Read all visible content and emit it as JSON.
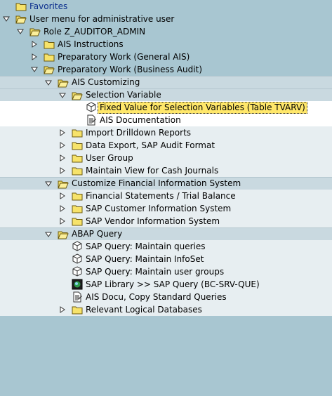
{
  "favorites": "Favorites",
  "user_menu": "User menu for administrative user",
  "role": "Role Z_AUDITOR_ADMIN",
  "ais_instructions": "AIS Instructions",
  "prep_general": "Preparatory Work (General AIS)",
  "prep_business": "Preparatory Work (Business Audit)",
  "ais_customizing": "AIS Customizing",
  "selection_variable": "Selection Variable",
  "fixed_value": "Fixed Value for Selection Variables (Table TVARV)",
  "ais_documentation": "AIS Documentation",
  "import_drilldown": "Import Drilldown Reports",
  "data_export": "Data Export, SAP Audit Format",
  "user_group": "User Group",
  "maintain_view": "Maintain View for Cash Journals",
  "customize_fis": "Customize Financial Information System",
  "fin_statements": "Financial Statements / Trial Balance",
  "sap_cis": "SAP Customer Information System",
  "sap_vis": "SAP Vendor Information System",
  "abap_query": "ABAP Query",
  "q_queries": "SAP Query: Maintain queries",
  "q_infoset": "SAP Query: Maintain InfoSet",
  "q_usergroups": "SAP Query: Maintain user groups",
  "q_library": "SAP Library >> SAP Query (BC-SRV-QUE)",
  "q_docu": "AIS Docu, Copy Standard Queries",
  "q_logical": "Relevant Logical Databases",
  "colors": {
    "background": "#a8c6d1",
    "selection": "#ffe76a",
    "folder": "#f7e36a"
  }
}
